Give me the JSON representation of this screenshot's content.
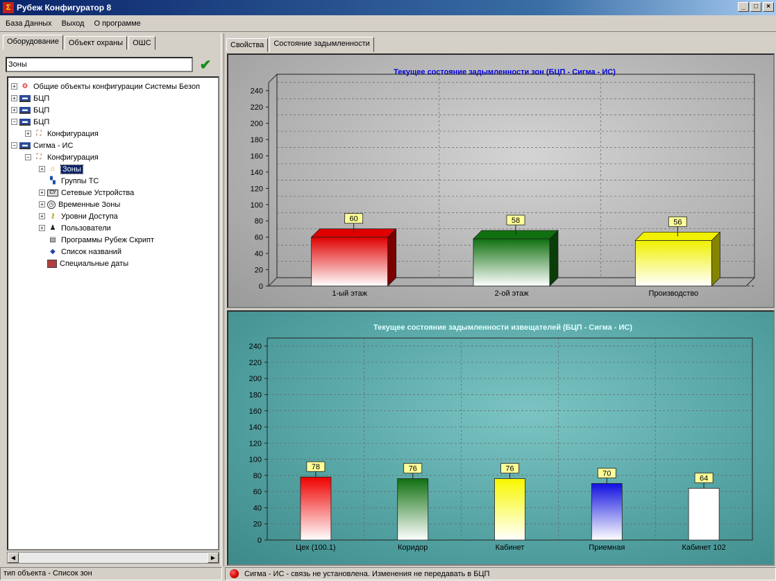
{
  "window": {
    "title": "Рубеж Конфигуратор 8",
    "icon": "sigma-icon",
    "min": "_",
    "max": "□",
    "close": "×"
  },
  "menu": [
    "База Данных",
    "Выход",
    "О программе"
  ],
  "left": {
    "tabs": [
      "Оборудование",
      "Объект охраны",
      "ОШС"
    ],
    "search_value": "Зоны",
    "tree": [
      {
        "label": "Общие объекты конфигурации Системы Безоп",
        "icon": "org-icon",
        "level": 0,
        "exp": "+"
      },
      {
        "label": "БЦП",
        "icon": "device-icon",
        "level": 0,
        "exp": "+"
      },
      {
        "label": "БЦП",
        "icon": "device-icon",
        "level": 0,
        "exp": "+"
      },
      {
        "label": "БЦП",
        "icon": "device-icon",
        "level": 0,
        "exp": "−"
      },
      {
        "label": "Конфигурация",
        "icon": "config-icon",
        "level": 1,
        "exp": "+"
      },
      {
        "label": "Сигма - ИС",
        "icon": "device-icon",
        "level": 0,
        "exp": "−"
      },
      {
        "label": "Конфигурация",
        "icon": "config-icon",
        "level": 1,
        "exp": "−"
      },
      {
        "label": "Зоны",
        "icon": "home-icon",
        "level": 2,
        "exp": "+",
        "selected": true
      },
      {
        "label": "Группы ТС",
        "icon": "group-icon",
        "level": 2,
        "exp": ""
      },
      {
        "label": "Сетевые Устройства",
        "icon": "network-icon",
        "level": 2,
        "exp": "+"
      },
      {
        "label": "Временные Зоны",
        "icon": "clock-icon",
        "level": 2,
        "exp": "+"
      },
      {
        "label": "Уровни Доступа",
        "icon": "key-icon",
        "level": 2,
        "exp": "+"
      },
      {
        "label": "Пользователи",
        "icon": "users-icon",
        "level": 2,
        "exp": "+"
      },
      {
        "label": "Программы Рубеж Скрипт",
        "icon": "script-icon",
        "level": 2,
        "exp": ""
      },
      {
        "label": "Список названий",
        "icon": "list-icon",
        "level": 2,
        "exp": ""
      },
      {
        "label": "Специальные даты",
        "icon": "calendar-icon",
        "level": 2,
        "exp": ""
      }
    ]
  },
  "right": {
    "tabs": [
      "Свойства",
      "Состояние задымленности"
    ]
  },
  "status": {
    "left": "тип объекта - Список зон",
    "right": "Сигма - ИС - связь не установлена. Изменения не передавать в БЦП",
    "indicator_color": "#d00000"
  },
  "chart_data": [
    {
      "type": "bar",
      "title": "Текущее состояние задымленности зон (БЦП - Сигма - ИС)",
      "categories": [
        "1-ый этаж",
        "2-ой этаж",
        "Производство"
      ],
      "values": [
        60,
        58,
        56
      ],
      "colors": [
        "#e00000",
        "#107010",
        "#f0f000"
      ],
      "ylim": [
        0,
        250
      ],
      "yticks": [
        0,
        20,
        40,
        60,
        80,
        100,
        120,
        140,
        160,
        180,
        200,
        220,
        240
      ],
      "three_d": true,
      "grid": true,
      "title_color": "#0000e0"
    },
    {
      "type": "bar",
      "title": "Текущее состояние задымленности извещателей (БЦП - Сигма - ИС)",
      "categories": [
        "Цех (100.1)",
        "Коридор",
        "Кабинет",
        "Приемная",
        "Кабинет 102"
      ],
      "values": [
        78,
        76,
        76,
        70,
        64
      ],
      "colors": [
        "#f00000",
        "#107010",
        "#f8f800",
        "#1010e0",
        "#ffffff"
      ],
      "ylim": [
        0,
        250
      ],
      "yticks": [
        0,
        20,
        40,
        60,
        80,
        100,
        120,
        140,
        160,
        180,
        200,
        220,
        240
      ],
      "three_d": false,
      "grid": true,
      "title_color": "#e0ffff"
    }
  ]
}
